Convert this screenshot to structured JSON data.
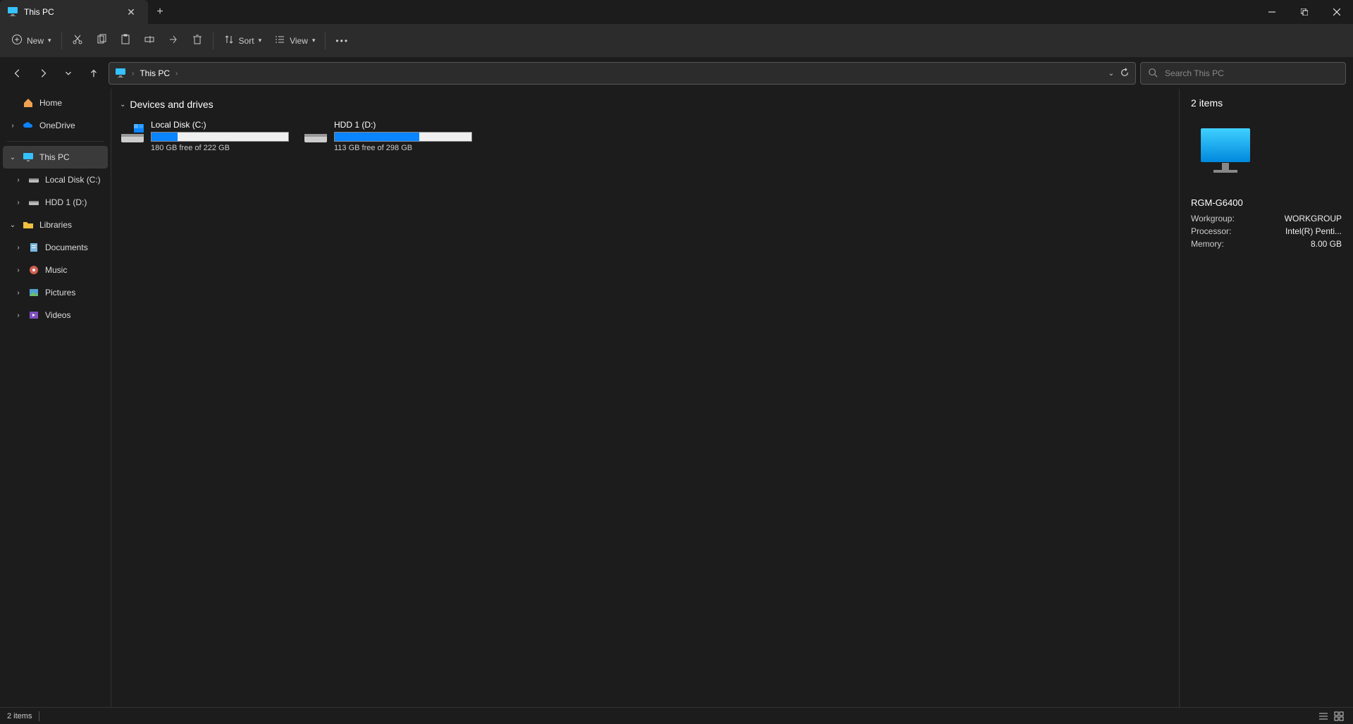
{
  "tab": {
    "title": "This PC"
  },
  "toolbar": {
    "new": "New",
    "sort": "Sort",
    "view": "View"
  },
  "breadcrumb": {
    "item0": "This PC"
  },
  "search": {
    "placeholder": "Search This PC"
  },
  "sidebar": {
    "home": "Home",
    "onedrive": "OneDrive",
    "thispc": "This PC",
    "localdisk": "Local Disk (C:)",
    "hdd1": "HDD 1 (D:)",
    "libraries": "Libraries",
    "documents": "Documents",
    "music": "Music",
    "pictures": "Pictures",
    "videos": "Videos"
  },
  "main": {
    "group_header": "Devices and drives",
    "drives": [
      {
        "name": "Local Disk (C:)",
        "free_text": "180 GB free of 222 GB",
        "used_pct": 19
      },
      {
        "name": "HDD 1 (D:)",
        "free_text": "113 GB free of 298 GB",
        "used_pct": 62
      }
    ]
  },
  "details": {
    "header": "2 items",
    "name": "RGM-G6400",
    "rows": {
      "workgroup_label": "Workgroup:",
      "workgroup_value": "WORKGROUP",
      "processor_label": "Processor:",
      "processor_value": "Intel(R) Penti...",
      "memory_label": "Memory:",
      "memory_value": "8.00 GB"
    }
  },
  "statusbar": {
    "text": "2 items"
  }
}
